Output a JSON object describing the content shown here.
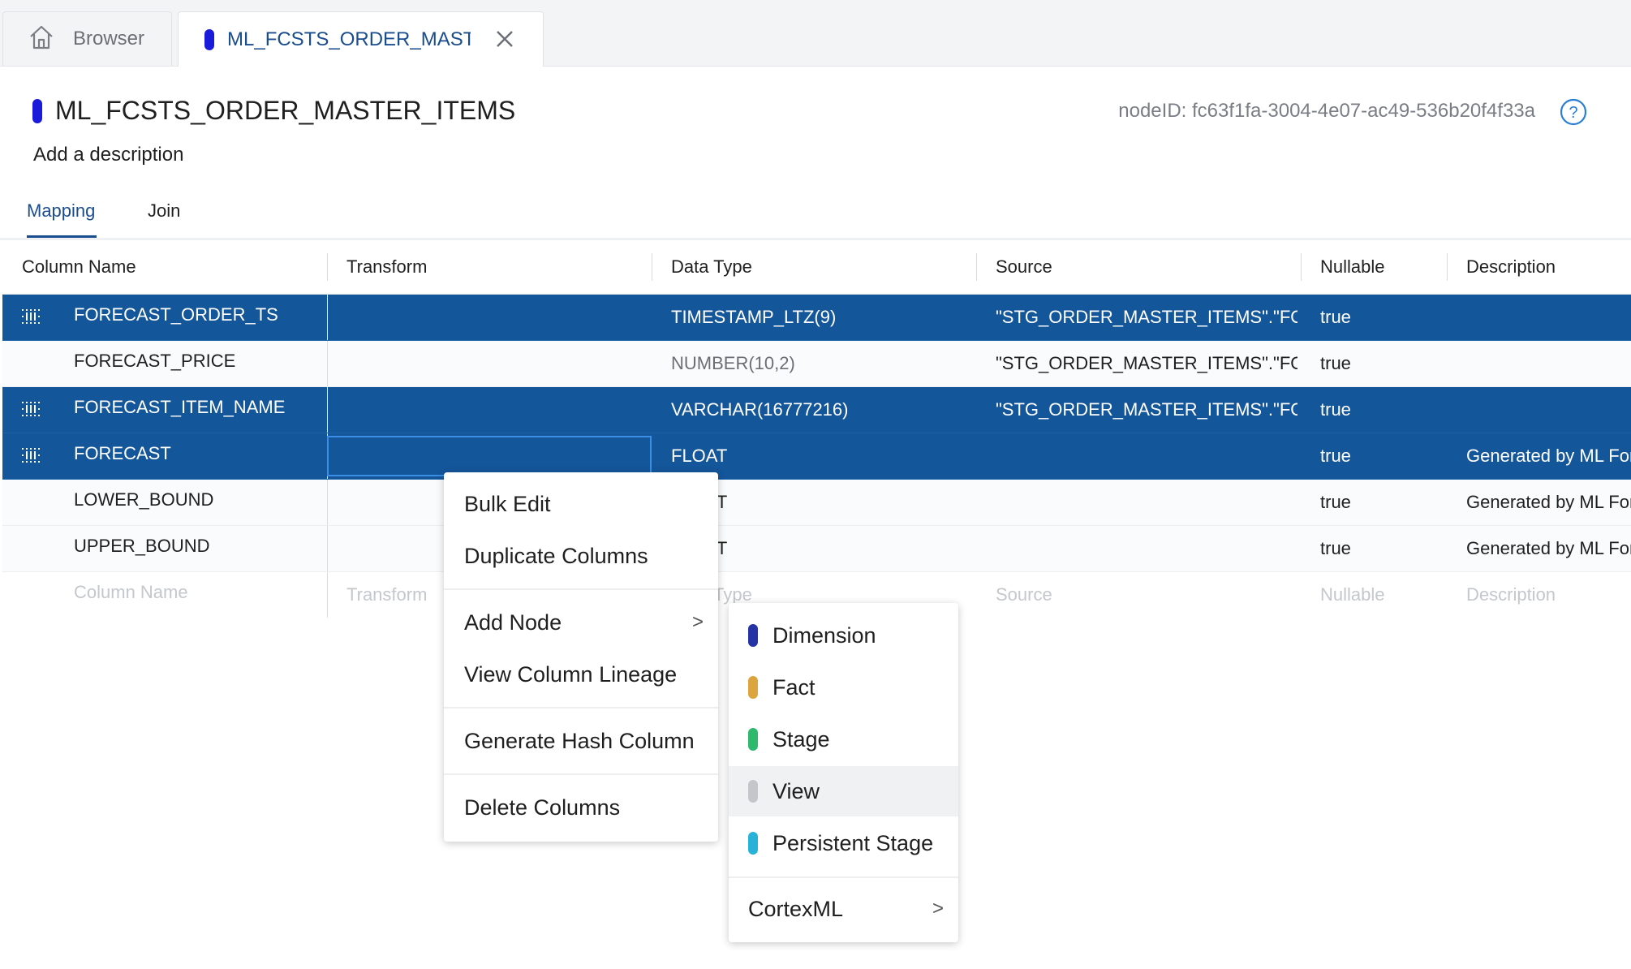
{
  "tabs": [
    {
      "label": "Browser",
      "icon": "home-icon"
    },
    {
      "label": "ML_FCSTS_ORDER_MAST...",
      "icon": "node-pill-icon",
      "pill_color": "#1a1adb"
    }
  ],
  "header": {
    "title": "ML_FCSTS_ORDER_MASTER_ITEMS",
    "description": "Add a description",
    "node_id": "nodeID: fc63f1fa-3004-4e07-ac49-536b20f4f33a"
  },
  "subtabs": [
    {
      "label": "Mapping",
      "active": true
    },
    {
      "label": "Join",
      "active": false
    }
  ],
  "table": {
    "columns": [
      "Column Name",
      "Transform",
      "Data Type",
      "Source",
      "Nullable",
      "Description"
    ],
    "rows": [
      {
        "name": "FORECAST_ORDER_TS",
        "transform": "",
        "type": "TIMESTAMP_LTZ(9)",
        "source": "\"STG_ORDER_MASTER_ITEMS\".\"FORECAST_ORDER_TS\"",
        "nullable": "true",
        "description": "",
        "selected": true
      },
      {
        "name": "FORECAST_PRICE",
        "transform": "",
        "type": "NUMBER(10,2)",
        "source": "\"STG_ORDER_MASTER_ITEMS\".\"FORECAST_PRICE\"",
        "nullable": "true",
        "description": "",
        "selected": false
      },
      {
        "name": "FORECAST_ITEM_NAME",
        "transform": "",
        "type": "VARCHAR(16777216)",
        "source": "\"STG_ORDER_MASTER_ITEMS\".\"FORECAST_ITEM_NAME\"",
        "nullable": "true",
        "description": "",
        "selected": true
      },
      {
        "name": "FORECAST",
        "transform": "",
        "type": "FLOAT",
        "source": "",
        "nullable": "true",
        "description": "Generated by ML Forecast",
        "selected": true
      },
      {
        "name": "LOWER_BOUND",
        "transform": "",
        "type": "FLOAT",
        "source": "",
        "nullable": "true",
        "description": "Generated by ML Forecast",
        "selected": false
      },
      {
        "name": "UPPER_BOUND",
        "transform": "",
        "type": "FLOAT",
        "source": "",
        "nullable": "true",
        "description": "Generated by ML Forecast",
        "selected": false
      }
    ],
    "placeholder": {
      "name": "Column Name",
      "transform": "Transform",
      "type": "Data Type",
      "source": "Source",
      "nullable": "Nullable",
      "description": "Description"
    }
  },
  "context_menu": {
    "items": [
      "Bulk Edit",
      "Duplicate Columns",
      "Add Node",
      "View Column Lineage",
      "Generate Hash Column",
      "Delete Columns"
    ]
  },
  "submenu": {
    "items": [
      {
        "label": "Dimension",
        "color": "#2633a5"
      },
      {
        "label": "Fact",
        "color": "#dca43c"
      },
      {
        "label": "Stage",
        "color": "#2fb96f"
      },
      {
        "label": "View",
        "color": "#c4c6c9"
      },
      {
        "label": "Persistent Stage",
        "color": "#27b3d8"
      }
    ],
    "cortex_label": "CortexML"
  },
  "colors": {
    "accent": "#1a4d8f",
    "selected_row": "#14569a"
  }
}
